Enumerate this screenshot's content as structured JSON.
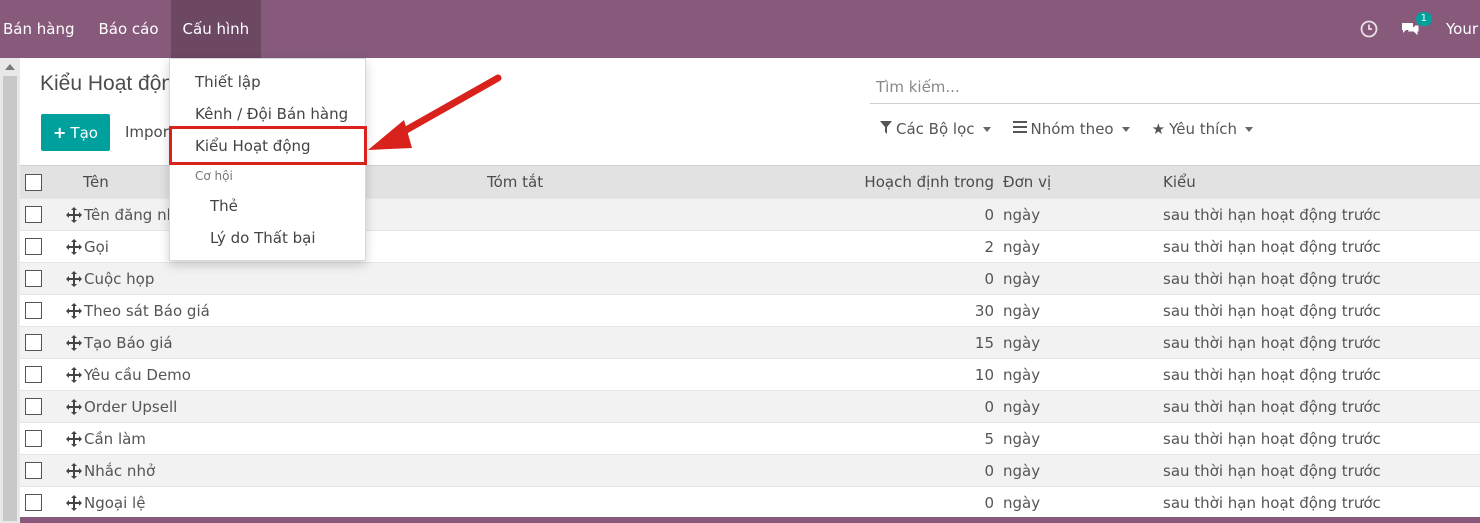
{
  "navbar": {
    "menu": [
      "Bán hàng",
      "Báo cáo",
      "Cấu hình"
    ],
    "active": "Cấu hình",
    "clock_icon": "clock-icon",
    "chat_icon": "chat-icon",
    "chat_badge": "1",
    "user": "Your"
  },
  "page": {
    "title": "Kiểu Hoạt động",
    "create_button": "Tạo",
    "import_button": "Import"
  },
  "search": {
    "placeholder": "Tìm kiếm...",
    "filters": "Các Bộ lọc",
    "group_by": "Nhóm theo",
    "favorites": "Yêu thích"
  },
  "dropdown": {
    "items": [
      "Thiết lập",
      "Kênh / Đội Bán hàng",
      "Kiểu Hoạt động"
    ],
    "section": "Cơ hội",
    "sub_items": [
      "Thẻ",
      "Lý do Thất bại"
    ],
    "highlighted": "Kiểu Hoạt động",
    "highlight_color": "#d9221c"
  },
  "table": {
    "headers": [
      "Tên",
      "Tóm tắt",
      "Hoạch định trong",
      "Đơn vị",
      "Kiểu"
    ],
    "rows": [
      {
        "name": "Tên đăng nhập",
        "summary": "",
        "plan": "0",
        "unit": "ngày",
        "type": "sau thời hạn hoạt động trước"
      },
      {
        "name": "Gọi",
        "summary": "",
        "plan": "2",
        "unit": "ngày",
        "type": "sau thời hạn hoạt động trước"
      },
      {
        "name": "Cuộc họp",
        "summary": "",
        "plan": "0",
        "unit": "ngày",
        "type": "sau thời hạn hoạt động trước"
      },
      {
        "name": "Theo sát Báo giá",
        "summary": "",
        "plan": "30",
        "unit": "ngày",
        "type": "sau thời hạn hoạt động trước"
      },
      {
        "name": "Tạo Báo giá",
        "summary": "",
        "plan": "15",
        "unit": "ngày",
        "type": "sau thời hạn hoạt động trước"
      },
      {
        "name": "Yêu cầu Demo",
        "summary": "",
        "plan": "10",
        "unit": "ngày",
        "type": "sau thời hạn hoạt động trước"
      },
      {
        "name": "Order Upsell",
        "summary": "",
        "plan": "0",
        "unit": "ngày",
        "type": "sau thời hạn hoạt động trước"
      },
      {
        "name": "Cần làm",
        "summary": "",
        "plan": "5",
        "unit": "ngày",
        "type": "sau thời hạn hoạt động trước"
      },
      {
        "name": "Nhắc nhở",
        "summary": "",
        "plan": "0",
        "unit": "ngày",
        "type": "sau thời hạn hoạt động trước"
      },
      {
        "name": "Ngoại lệ",
        "summary": "",
        "plan": "0",
        "unit": "ngày",
        "type": "sau thời hạn hoạt động trước"
      }
    ]
  },
  "colors": {
    "brand": "#875a7b",
    "primary_button": "#00a09d",
    "annotation": "#d9221c"
  }
}
